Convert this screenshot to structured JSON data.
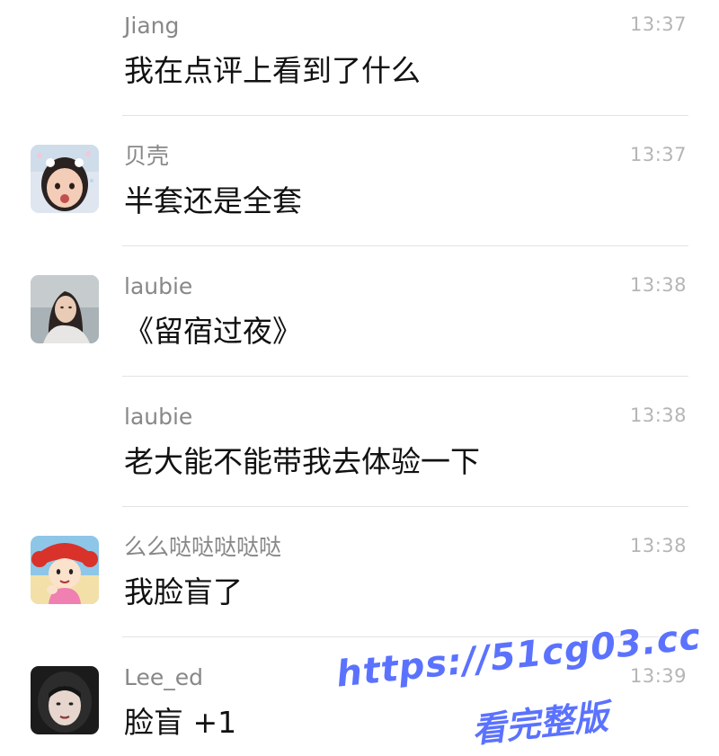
{
  "messages": [
    {
      "sender": "Jiang",
      "time": "13:37",
      "text": "我在点评上看到了什么",
      "avatar": "none"
    },
    {
      "sender": "贝壳",
      "time": "13:37",
      "text": "半套还是全套",
      "avatar": "child-photo-avatar"
    },
    {
      "sender": "laubie",
      "time": "13:38",
      "text": "《留宿过夜》",
      "avatar": "woman-photo-avatar"
    },
    {
      "sender": "laubie",
      "time": "13:38",
      "text": "老大能不能带我去体验一下",
      "avatar": "none"
    },
    {
      "sender": "么么哒哒哒哒哒",
      "time": "13:38",
      "text": "我脸盲了",
      "avatar": "cartoon-girl-avatar"
    },
    {
      "sender": "Lee_ed",
      "time": "13:39",
      "text": "脸盲 +1",
      "avatar": "helmet-girl-avatar"
    }
  ],
  "watermark": {
    "line1": "https://51cg03.cc",
    "line2": "看完整版",
    "color": "#5b72ff"
  },
  "colors": {
    "sender": "#888888",
    "time": "#b5b5b5",
    "text": "#111111",
    "divider": "#e3e3e3"
  }
}
